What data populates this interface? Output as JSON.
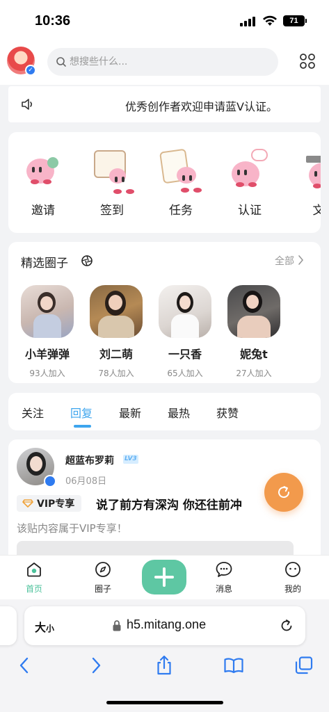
{
  "status_bar": {
    "time": "10:36",
    "battery": "71"
  },
  "header": {
    "search_placeholder": "想搜些什么..."
  },
  "notice": {
    "text": "优秀创作者欢迎申请蓝V认证。"
  },
  "quick_entries": [
    {
      "label": "邀请",
      "icon": "kirby-invite-icon"
    },
    {
      "label": "签到",
      "icon": "kirby-checkin-icon"
    },
    {
      "label": "任务",
      "icon": "kirby-task-icon"
    },
    {
      "label": "认证",
      "icon": "kirby-verify-icon"
    },
    {
      "label": "文",
      "icon": "kirby-article-icon"
    }
  ],
  "circles": {
    "title": "精选圈子",
    "all_label": "全部",
    "items": [
      {
        "name": "小羊弹弹",
        "count": "93人加入"
      },
      {
        "name": "刘二萌",
        "count": "78人加入"
      },
      {
        "name": "一只香",
        "count": "65人加入"
      },
      {
        "name": "妮兔t",
        "count": "27人加入"
      }
    ]
  },
  "tabs": [
    {
      "label": "关注",
      "active": false
    },
    {
      "label": "回复",
      "active": true
    },
    {
      "label": "最新",
      "active": false
    },
    {
      "label": "最热",
      "active": false
    },
    {
      "label": "获赞",
      "active": false
    }
  ],
  "post": {
    "author": "超蓝布罗莉",
    "level": "LV3",
    "date": "06月08日",
    "badge": "VIP专享",
    "title": "说了前方有深沟 你还往前冲",
    "description": "该贴内容属于VIP专享！"
  },
  "bottom_nav": [
    {
      "label": "首页",
      "active": true
    },
    {
      "label": "圈子",
      "active": false
    },
    {
      "label": "消息",
      "active": false
    },
    {
      "label": "我的",
      "active": false
    }
  ],
  "browser": {
    "text_size_label": "大",
    "text_size_small": "小",
    "url": "h5.mitang.one"
  },
  "colors": {
    "accent_blue": "#3da5ee",
    "accent_green": "#5ec7a3",
    "fab_orange": "#f29a4c"
  }
}
